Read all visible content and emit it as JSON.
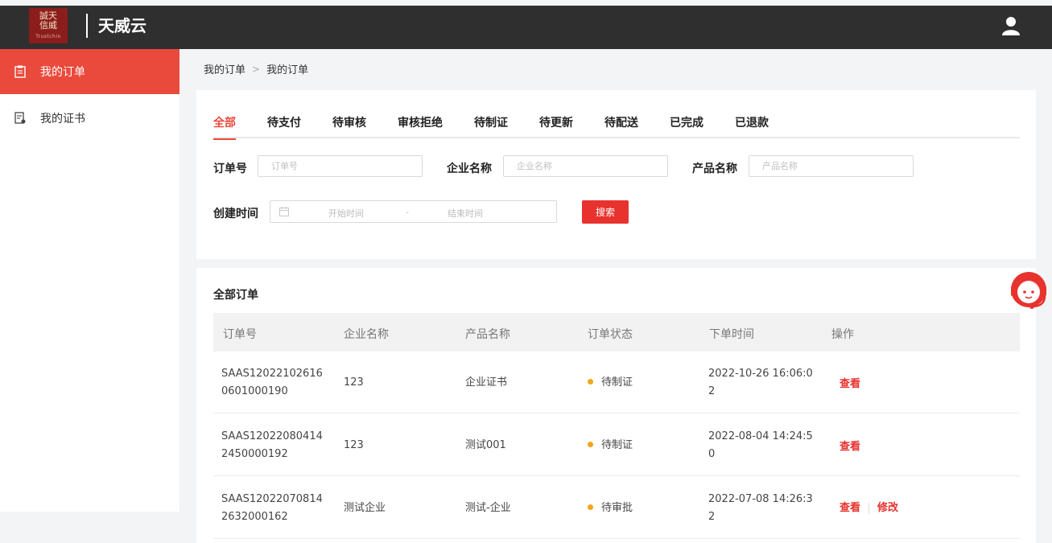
{
  "header": {
    "logo_text_top": "誠天",
    "logo_text_bottom": "信威",
    "logo_small": "Trustchin",
    "app_title": "天威云",
    "user_icon": "user-icon"
  },
  "sidebar": {
    "items": [
      {
        "label": "我的订单",
        "icon": "order-clipboard-icon",
        "active": true
      },
      {
        "label": "我的证书",
        "icon": "certificate-icon",
        "active": false
      }
    ]
  },
  "breadcrumb": [
    "我的订单",
    "我的订单"
  ],
  "filter": {
    "tabs": [
      "全部",
      "待支付",
      "待审核",
      "审核拒绝",
      "待制证",
      "待更新",
      "待配送",
      "已完成",
      "已退款"
    ],
    "order_no_label": "订单号",
    "order_no_placeholder": "订单号",
    "company_label": "企业名称",
    "company_placeholder": "企业名称",
    "product_label": "产品名称",
    "product_placeholder": "产品名称",
    "created_label": "创建时间",
    "start_placeholder": "开始时间",
    "range_sep": "-",
    "end_placeholder": "结束时间",
    "search_label": "搜索"
  },
  "orders": {
    "title": "全部订单",
    "columns": [
      "订单号",
      "企业名称",
      "产品名称",
      "订单状态",
      "下单时间",
      "操作"
    ],
    "rows": [
      {
        "order_no_1": "SAAS12022102616",
        "order_no_2": "0601000190",
        "company": "123",
        "product": "企业证书",
        "status": "待制证",
        "time_1": "2022-10-26 16:06:0",
        "time_2": "2",
        "view": "查看",
        "edit": ""
      },
      {
        "order_no_1": "SAAS12022080414",
        "order_no_2": "2450000192",
        "company": "123",
        "product": "测试001",
        "status": "待制证",
        "time_1": "2022-08-04 14:24:5",
        "time_2": "0",
        "view": "查看",
        "edit": ""
      },
      {
        "order_no_1": "SAAS12022070814",
        "order_no_2": "2632000162",
        "company": "测试企业",
        "product": "测试-企业",
        "status": "待审批",
        "time_1": "2022-07-08 14:26:3",
        "time_2": "2",
        "view": "查看",
        "edit": "修改"
      }
    ]
  },
  "colors": {
    "accent": "#ea4a3c",
    "topbar": "#2f2f2f",
    "status_pending": "#f2a61d"
  },
  "support_icon": "customer-service-icon"
}
